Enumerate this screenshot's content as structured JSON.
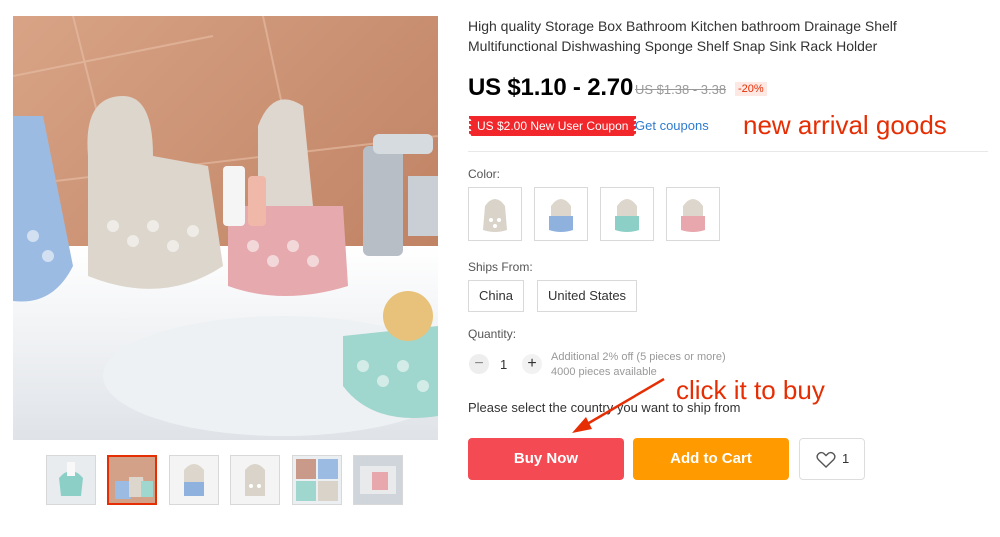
{
  "product": {
    "title": "High quality Storage Box Bathroom Kitchen bathroom Drainage Shelf Multifunctional Dishwashing Sponge Shelf Snap Sink Rack Holder",
    "price": "US $1.10 - 2.70",
    "old_price": "US $1.38 - 3.38",
    "discount": "-20%",
    "coupon_label": "US $2.00 New User Coupon",
    "get_coupons": "Get coupons",
    "promo_text": "new arrival goods"
  },
  "color": {
    "label": "Color:",
    "options": [
      {
        "name": "beige",
        "color": "#d9d3c9"
      },
      {
        "name": "blue",
        "color": "#8fb1dd"
      },
      {
        "name": "green",
        "color": "#8ccfc6"
      },
      {
        "name": "pink",
        "color": "#e7a7ad"
      }
    ]
  },
  "ships_from": {
    "label": "Ships From:",
    "options": [
      "China",
      "United States"
    ]
  },
  "quantity": {
    "label": "Quantity:",
    "value": "1",
    "minus": "−",
    "plus": "+",
    "discount_note": "Additional 2% off (5 pieces or more)",
    "available": "4000 pieces available"
  },
  "shipping_prompt": "Please select the country you want to ship from",
  "click_note": "click it to buy",
  "actions": {
    "buy_now": "Buy Now",
    "add_to_cart": "Add to Cart",
    "wishlist_count": "1"
  },
  "colors": {
    "accent_red": "#e62e04",
    "buy_button": "#f44a53",
    "cart_button": "#ff9a00",
    "link_blue": "#2e7bcf"
  }
}
